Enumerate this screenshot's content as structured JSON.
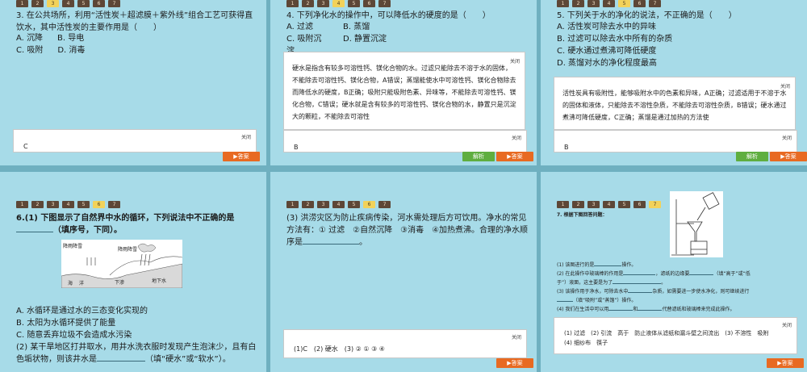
{
  "tabs": [
    "1",
    "2",
    "3",
    "4",
    "5",
    "6",
    "7"
  ],
  "close_label": "关闭",
  "answer_btn": "▶答案",
  "explain_btn": "解析",
  "slide1": {
    "question": "3. 在公共场所，利用“活性炭＋超滤膜＋紫外线”组合工艺可获得直饮水，其中活性炭的主要作用是（　　）",
    "options": [
      "A. 沉降",
      "B. 导电",
      "C. 吸附",
      "D. 消毒"
    ],
    "answer": "C"
  },
  "slide2": {
    "question": "4. 下列净化水的操作中，可以降低水的硬度的是（　　）",
    "options": [
      "A. 过滤",
      "B. 蒸馏",
      "C. 吸附沉淀",
      "D. 静置沉淀"
    ],
    "explanation": "硬水是指含有较多可溶性钙、镁化合物的水。过滤只能除去不溶于水的固体，不能除去可溶性钙、镁化合物，A错误；蒸馏能使水中可溶性钙、镁化合物除去而降低水的硬度，B正确；吸附只能吸附色素、异味等，不能除去可溶性钙、镁化合物，C错误；硬水就是含有较多的可溶性钙、镁化合物的水，静置只是沉淀大的颗粒，不能除去可溶性",
    "answer": "B"
  },
  "slide3": {
    "question": "5. 下列关于水的净化的说法，不正确的是（　　）",
    "options": [
      "A. 活性炭可除去水中的异味",
      "B. 过滤可以除去水中所有的杂质",
      "C. 硬水通过煮沸可降低硬度",
      "D. 蒸馏对水的净化程度最高"
    ],
    "explanation": "活性炭具有吸附性，能够吸附水中的色素和异味，A正确；过滤适用于不溶于水的固体和液体，只能除去不溶性杂质，不能除去可溶性杂质，B错误；硬水通过煮沸可降低硬度，C正确；蒸馏是通过加热的方法使",
    "answer": "B"
  },
  "slide4": {
    "question_a": "6.(1) 下图显示了自然界中水的循环，下列说法中不正确的是",
    "question_b": "（填序号，下同）。",
    "diagram_labels": [
      "降雨降雪",
      "降雨降雪",
      "海",
      "洋",
      "下渗",
      "地下水"
    ],
    "options": [
      "A. 水循环是通过水的三态变化实现的",
      "B. 太阳为水循环提供了能量",
      "C. 随意丢弃垃圾不会造成水污染"
    ],
    "question2_a": "(2) 某干旱地区打井取水，用井水洗衣服时发现产生泡沫少，且有白色垢状物，则该井水是",
    "question2_b": "（填“硬水”或“软水”）。"
  },
  "slide5": {
    "question_a": "(3) 洪涝灾区为防止疾病传染，河水需处理后方可饮用。净水的常见方法有：① 过滤　②自然沉降　③消毒　④加热煮沸。合理的净水顺序是",
    "question_b": "。",
    "answer": "(1)C　(2) 硬水　(3) ② ① ③ ④"
  },
  "slide6": {
    "title": "7. 根据下图回答问题：",
    "lines": [
      "(1) 该图进行的是",
      "操作。",
      "(2) 在此操作中玻璃棒的作用是",
      "，滤纸的边缘要",
      "（填“高于”或“低",
      "于”）液面，这主要是为了",
      "。",
      "(3) 该操作用于净水，可除去水中",
      "杂质，如需要进一步使水净化，则可继续进行",
      "（填“吸附”或“蒸馏”）操作。",
      "(4) 我们在生活中可以用",
      "和",
      "代替滤纸和玻璃棒来完成此操作。"
    ],
    "answer_line1": "(1) 过滤　(2) 引流　高于　防止液体从滤纸和漏斗壁之间流出　(3) 不溶性　吸附",
    "answer_line2": "(4) 细纱布　筷子"
  }
}
